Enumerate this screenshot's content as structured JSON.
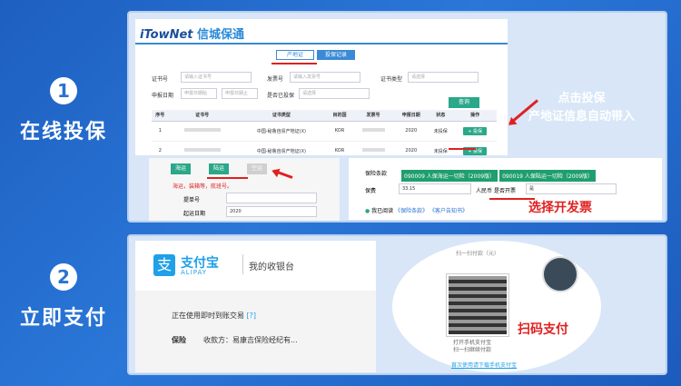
{
  "step1": {
    "num": "1",
    "label": "在线投保"
  },
  "step2": {
    "num": "2",
    "label": "立即支付"
  },
  "portal": {
    "logo": "iTowNet",
    "logo_cn": "信城保通",
    "tabs": [
      "产地证",
      "投保记录"
    ],
    "fields": {
      "cert_no": "证书号",
      "cert_no_ph": "请输入证书号",
      "invoice_no": "发票号",
      "invoice_no_ph": "请输入发票号",
      "cert_type": "证书类型",
      "cert_type_ph": "请选择",
      "apply_date": "申报日期",
      "date_start_ph": "申报日期始",
      "date_end_ph": "申报日期止",
      "insured": "是否已投保",
      "insured_ph": "请选择"
    },
    "query_btn": "查询",
    "columns": [
      "序号",
      "证书号",
      "证书类型",
      "目的国",
      "发票号",
      "申报日期",
      "状态",
      "操作"
    ],
    "rows": [
      {
        "idx": "1",
        "cert": "",
        "type": "中国-秘鲁自贸产地证(X)",
        "dest": "KOR",
        "inv": "",
        "date": "2020",
        "status": "未投保",
        "op": "+ 投保"
      },
      {
        "idx": "2",
        "cert": "",
        "type": "中国-秘鲁自贸产地证(X)",
        "dest": "KOR",
        "inv": "",
        "date": "2020",
        "status": "未投保",
        "op": "+ 投保"
      }
    ]
  },
  "callout1": {
    "line1": "点击投保",
    "line2": "产地证信息自动带入"
  },
  "mini": {
    "btn1": "海运",
    "btn2": "陆运",
    "btn3": "空运",
    "note": "海运，装箱等，航班号。",
    "f1": "提单号",
    "f2": "起运日期",
    "f2_val": "2020"
  },
  "clauses": {
    "label": "保险条款",
    "tag1": "090009 人保海运一切险（2009版）",
    "tag2": "090019 人保陆运一切险（2009版）",
    "premium": "保费",
    "premium_val": "33.15",
    "rmb": "人民币",
    "invoice_q": "是否开票",
    "invoice_val": "是",
    "agree": "我已阅读",
    "link1": "《保险条款》",
    "link2": "《客户告知书》"
  },
  "callout2": "选择开发票",
  "alipay": {
    "logo": "支付宝",
    "logo_en": "ALIPAY",
    "title": "我的收银台",
    "notice": "正在使用即时到账交易",
    "help": "[?]",
    "item": "保险",
    "payee": "收款方：易康吉保险经纪有..."
  },
  "qr": {
    "top": "扫一扫付款（元）",
    "foot1": "打开手机支付宝",
    "foot2": "扫一扫继续付款",
    "link": "首次使用请下载手机支付宝"
  },
  "callout3": "扫码支付"
}
